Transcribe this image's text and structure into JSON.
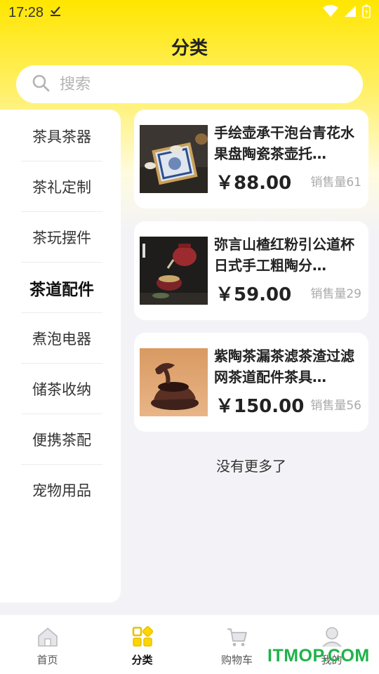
{
  "status_bar": {
    "time": "17:28"
  },
  "header": {
    "title": "分类"
  },
  "search": {
    "placeholder": "搜索"
  },
  "categories": [
    {
      "label": "茶具茶器",
      "active": false
    },
    {
      "label": "茶礼定制",
      "active": false
    },
    {
      "label": "茶玩摆件",
      "active": false
    },
    {
      "label": "茶道配件",
      "active": true
    },
    {
      "label": "煮泡电器",
      "active": false
    },
    {
      "label": "储茶收纳",
      "active": false
    },
    {
      "label": "便携茶配",
      "active": false
    },
    {
      "label": "宠物用品",
      "active": false
    }
  ],
  "products": [
    {
      "name": "手绘壶承干泡台青花水果盘陶瓷茶壶托…",
      "price": "￥88.00",
      "sales": "销售量61"
    },
    {
      "name": "弥言山楂红粉引公道杯日式手工粗陶分…",
      "price": "￥59.00",
      "sales": "销售量29"
    },
    {
      "name": "紫陶茶漏茶滤茶渣过滤网茶道配件茶具…",
      "price": "￥150.00",
      "sales": "销售量56"
    }
  ],
  "list_end": "没有更多了",
  "tabbar": [
    {
      "label": "首页",
      "icon": "home-icon",
      "active": false
    },
    {
      "label": "分类",
      "icon": "category-icon",
      "active": true
    },
    {
      "label": "购物车",
      "icon": "cart-icon",
      "active": false
    },
    {
      "label": "我的",
      "icon": "profile-icon",
      "active": false
    }
  ],
  "watermark": "ITMOP.COM",
  "colors": {
    "accent": "#ffe600",
    "background": "#f3f3f7",
    "watermark": "#1fb34a"
  }
}
